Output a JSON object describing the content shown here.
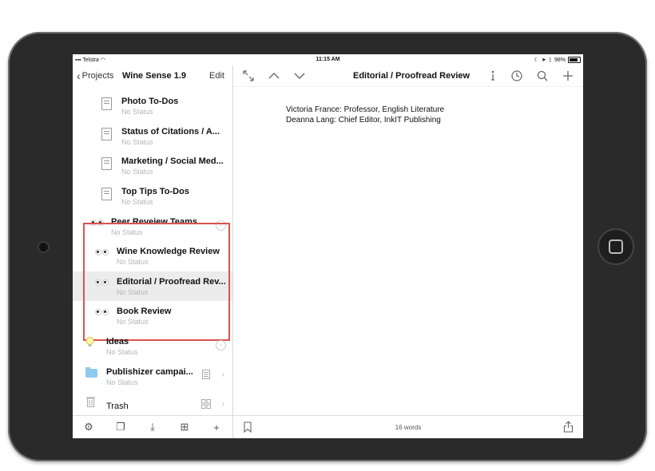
{
  "status": {
    "carrier": "Telstra",
    "time": "11:15 AM",
    "battery": "98%"
  },
  "sidebar": {
    "back_label": "Projects",
    "project_title": "Wine Sense 1.9",
    "edit_label": "Edit",
    "items": [
      {
        "title": "Photo To-Dos",
        "status": "No Status"
      },
      {
        "title": "Status of Citations / A...",
        "status": "No Status"
      },
      {
        "title": "Marketing / Social Med...",
        "status": "No Status"
      },
      {
        "title": "Top Tips To-Dos",
        "status": "No Status"
      },
      {
        "title": "Peer Reveiew Teams",
        "status": "No Status"
      },
      {
        "title": "Wine Knowledge Review",
        "status": "No Status"
      },
      {
        "title": "Editorial / Proofread Rev...",
        "status": "No Status"
      },
      {
        "title": "Book Review",
        "status": "No Status"
      },
      {
        "title": "Ideas",
        "status": "No Status"
      },
      {
        "title": "Publishizer campai...",
        "status": "No Status"
      },
      {
        "title": "Trash"
      }
    ]
  },
  "editor": {
    "title": "Editorial / Proofread Review",
    "lines": [
      "Victoria France: Professor, English Literature",
      "Deanna Lang: Chief Editor, InkIT Publishing"
    ],
    "word_count": "16 words"
  },
  "colors": {
    "highlight": "#d9534f",
    "folder": "#8ec9ef",
    "bulb": "#e8d34a"
  }
}
